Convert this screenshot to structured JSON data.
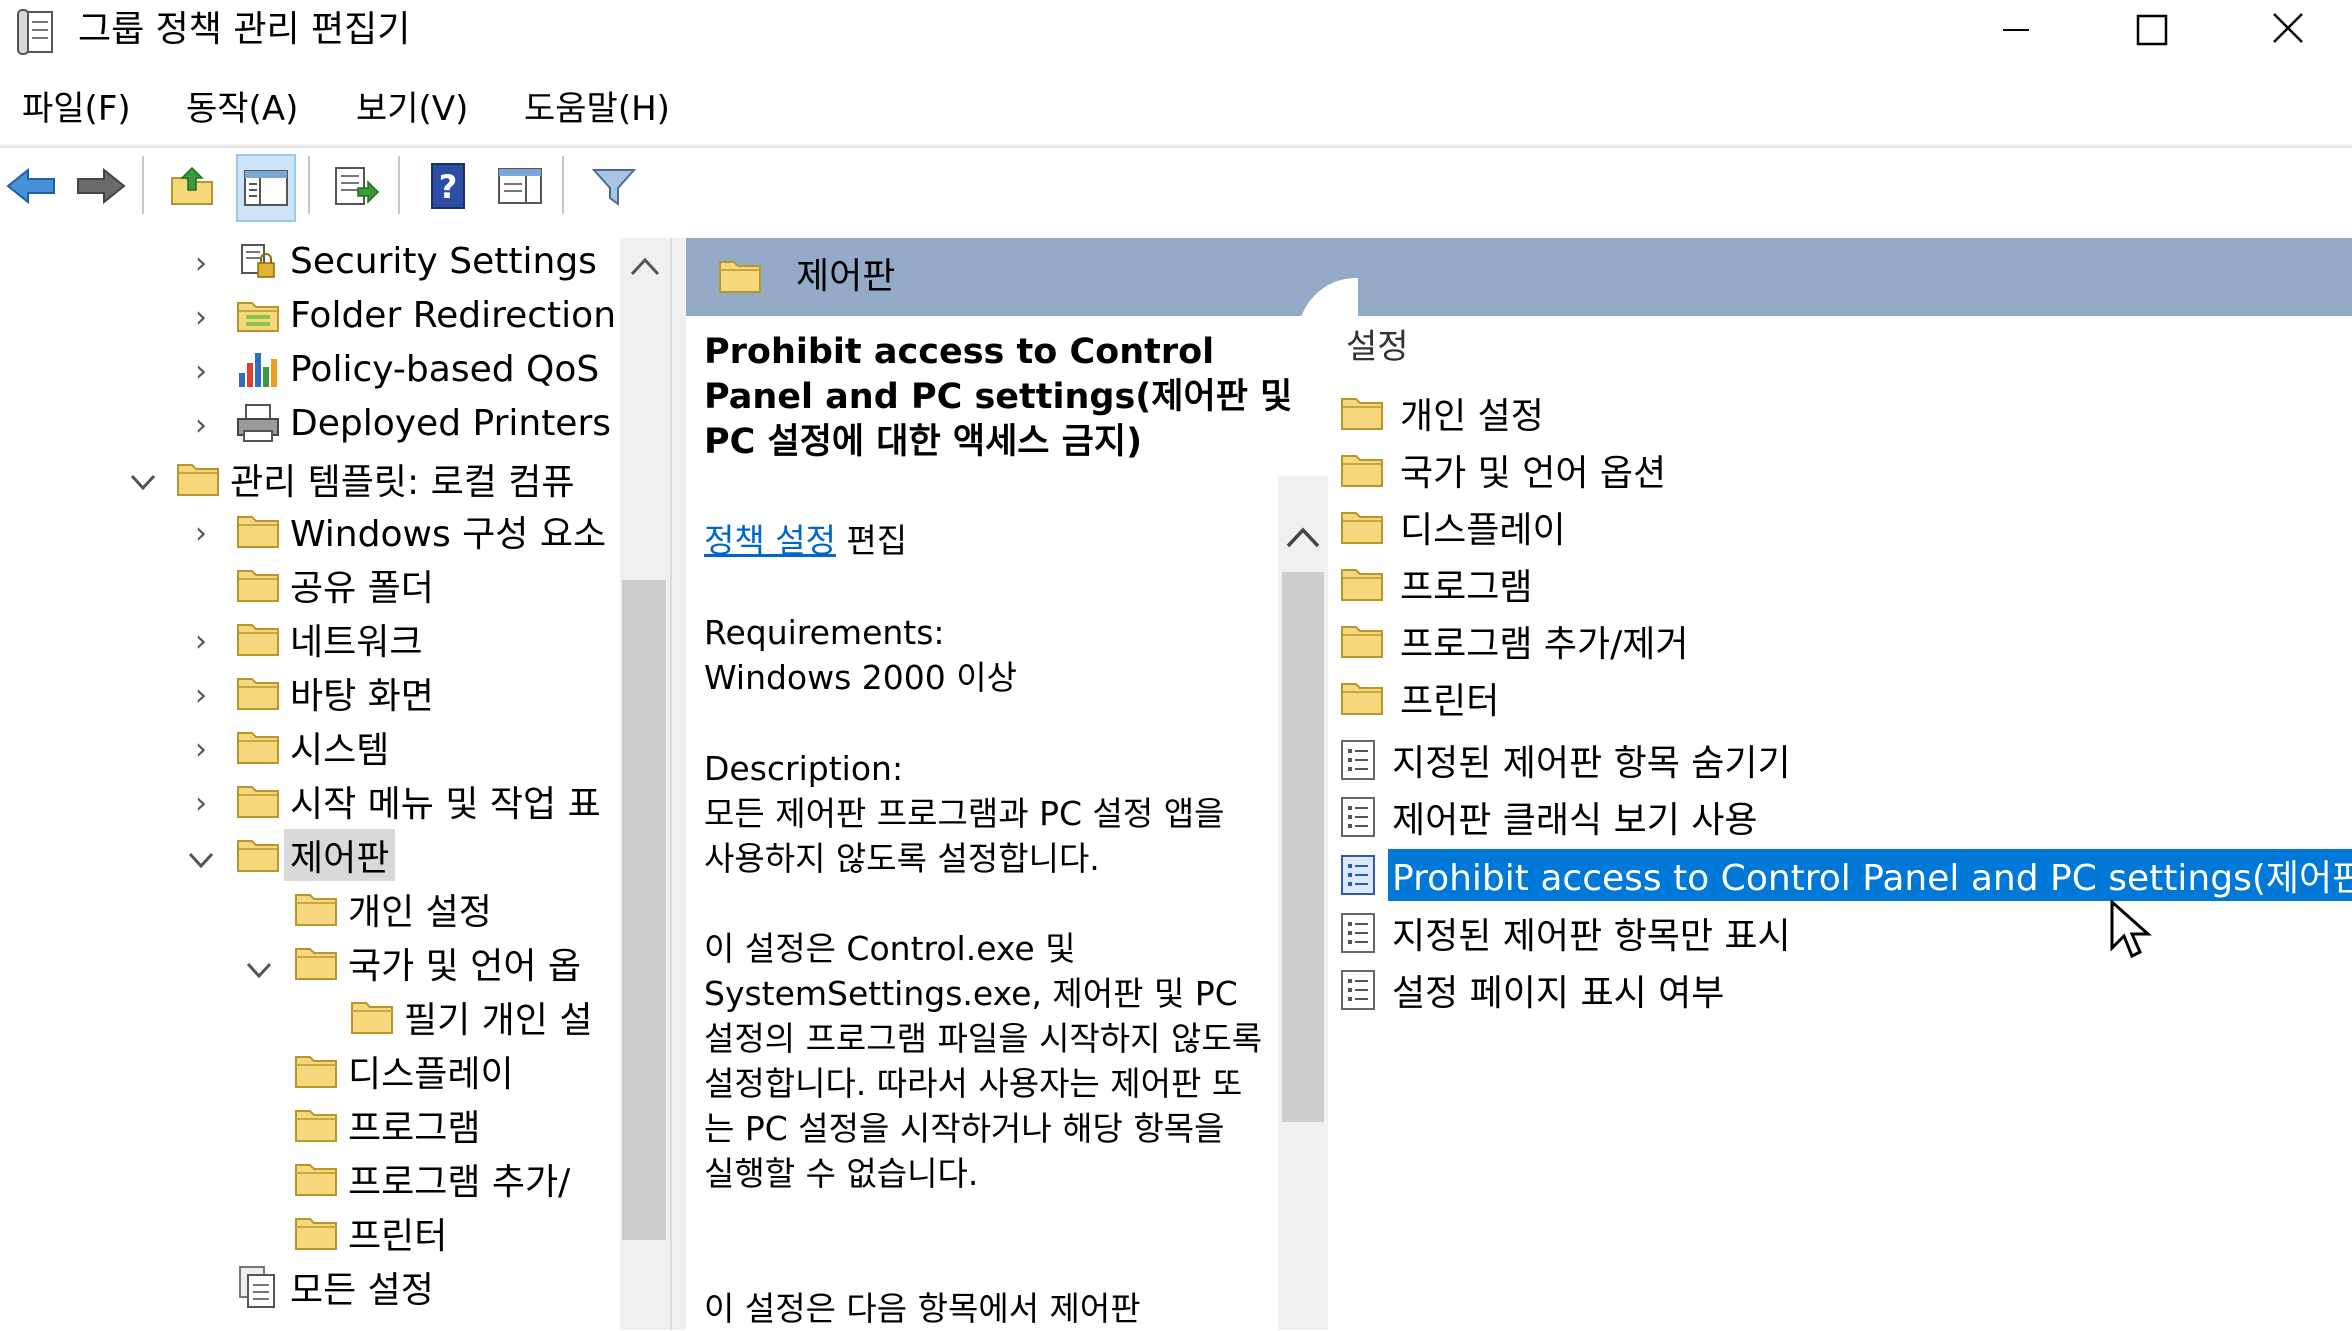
{
  "window": {
    "title": "그룹 정책 관리 편집기",
    "controls": {
      "minimize": "minimize",
      "maximize": "maximize",
      "close": "close"
    }
  },
  "menu": [
    "파일(F)",
    "동작(A)",
    "보기(V)",
    "도움말(H)"
  ],
  "toolbar": {
    "icons": [
      "back-arrow-icon",
      "forward-arrow-icon",
      "up-folder-icon",
      "show-hide-tree-icon",
      "export-list-icon",
      "help-icon",
      "properties-view-icon",
      "filter-icon"
    ]
  },
  "tree": {
    "items": [
      {
        "label": "Security Settings",
        "icon": "security-settings-icon",
        "expander": "collapsed"
      },
      {
        "label": "Folder Redirection",
        "icon": "folder-redirection-icon",
        "expander": "collapsed"
      },
      {
        "label": "Policy-based QoS",
        "icon": "qos-chart-icon",
        "expander": "collapsed"
      },
      {
        "label": "Deployed Printers",
        "icon": "printer-icon",
        "expander": "collapsed"
      },
      {
        "label": "관리 템플릿: 로컬 컴퓨",
        "icon": "folder-icon",
        "expander": "expanded"
      },
      {
        "label": "Windows 구성 요소",
        "icon": "folder-icon",
        "expander": "collapsed"
      },
      {
        "label": "공유 폴더",
        "icon": "folder-icon",
        "expander": "none"
      },
      {
        "label": "네트워크",
        "icon": "folder-icon",
        "expander": "collapsed"
      },
      {
        "label": "바탕 화면",
        "icon": "folder-icon",
        "expander": "collapsed"
      },
      {
        "label": "시스템",
        "icon": "folder-icon",
        "expander": "collapsed"
      },
      {
        "label": "시작 메뉴 및 작업 표",
        "icon": "folder-icon",
        "expander": "collapsed"
      },
      {
        "label": "제어판",
        "icon": "folder-icon",
        "expander": "expanded",
        "selected": true
      },
      {
        "label": "개인 설정",
        "icon": "folder-icon",
        "expander": "none"
      },
      {
        "label": "국가 및 언어 옵",
        "icon": "folder-icon",
        "expander": "expanded"
      },
      {
        "label": "필기 개인 설",
        "icon": "folder-icon",
        "expander": "none"
      },
      {
        "label": "디스플레이",
        "icon": "folder-icon",
        "expander": "none"
      },
      {
        "label": "프로그램",
        "icon": "folder-icon",
        "expander": "none"
      },
      {
        "label": "프로그램 추가/",
        "icon": "folder-icon",
        "expander": "none"
      },
      {
        "label": "프린터",
        "icon": "folder-icon",
        "expander": "none"
      },
      {
        "label": "모든 설정",
        "icon": "all-settings-icon",
        "expander": "none"
      }
    ]
  },
  "header": {
    "title": "제어판"
  },
  "description": {
    "title": "Prohibit access to Control Panel and PC settings(제어판 및 PC 설정에 대한 액세스 금지)",
    "edit_link": "정책 설정",
    "edit_suffix": " 편집",
    "requirements_label": "Requirements:",
    "requirements_value": "Windows 2000 이상",
    "description_label": "Description:",
    "paragraph1": "모든 제어판 프로그램과 PC 설정 앱을 사용하지 않도록 설정합니다.",
    "paragraph2": "이 설정은 Control.exe 및 SystemSettings.exe, 제어판 및 PC 설정의 프로그램 파일을 시작하지 않도록 설정합니다. 따라서 사용자는 제어판 또는 PC 설정을 시작하거나 해당 항목을 실행할 수 없습니다.",
    "paragraph3": "이 설정은 다음 항목에서 제어판"
  },
  "settings": {
    "column_header": "설정",
    "items": [
      {
        "label": "개인 설정",
        "type": "folder"
      },
      {
        "label": "국가 및 언어 옵션",
        "type": "folder"
      },
      {
        "label": "디스플레이",
        "type": "folder"
      },
      {
        "label": "프로그램",
        "type": "folder"
      },
      {
        "label": "프로그램 추가/제거",
        "type": "folder"
      },
      {
        "label": "프린터",
        "type": "folder"
      },
      {
        "label": "지정된 제어판 항목 숨기기",
        "type": "setting"
      },
      {
        "label": "제어판 클래식 보기 사용",
        "type": "setting"
      },
      {
        "label": "Prohibit access to Control Panel and PC settings(제어판 및",
        "type": "setting",
        "selected": true
      },
      {
        "label": "지정된 제어판 항목만 표시",
        "type": "setting"
      },
      {
        "label": "설정 페이지 표시 여부",
        "type": "setting"
      }
    ]
  },
  "colors": {
    "header_bar": "#94abc7",
    "selection": "#0078d7",
    "tree_selection": "#d9d9d9",
    "link": "#0066cc",
    "folder": "#f6d77c"
  }
}
